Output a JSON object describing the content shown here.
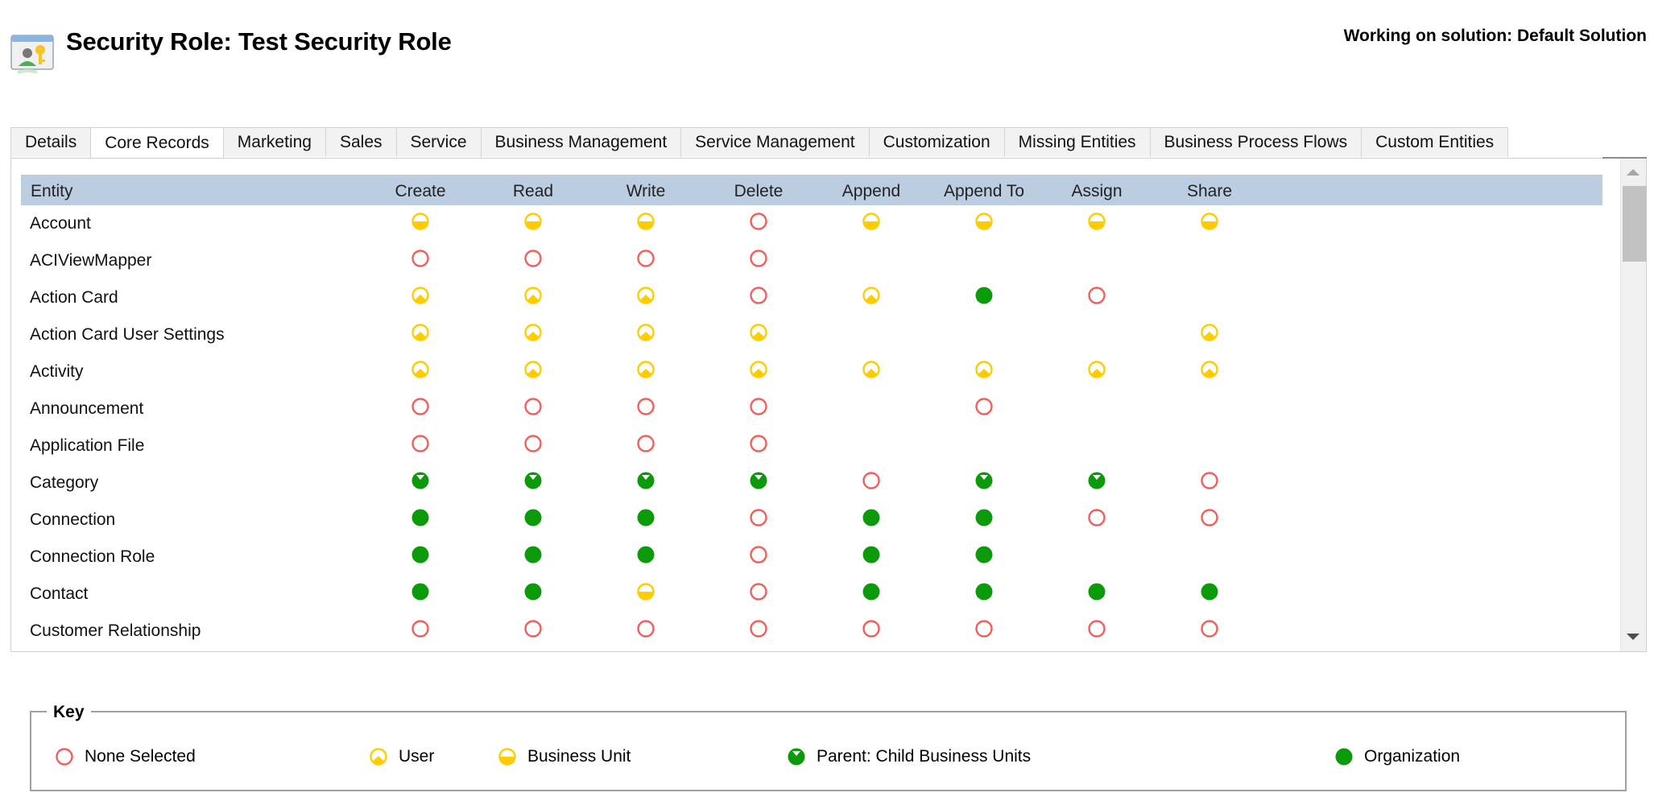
{
  "header": {
    "title": "Security Role: Test Security Role",
    "solution_label": "Working on solution: Default Solution",
    "icon": "security-role-icon"
  },
  "tabs": [
    {
      "label": "Details",
      "active": false
    },
    {
      "label": "Core Records",
      "active": true
    },
    {
      "label": "Marketing",
      "active": false
    },
    {
      "label": "Sales",
      "active": false
    },
    {
      "label": "Service",
      "active": false
    },
    {
      "label": "Business Management",
      "active": false
    },
    {
      "label": "Service Management",
      "active": false
    },
    {
      "label": "Customization",
      "active": false
    },
    {
      "label": "Missing Entities",
      "active": false
    },
    {
      "label": "Business Process Flows",
      "active": false
    },
    {
      "label": "Custom Entities",
      "active": false
    }
  ],
  "grid": {
    "columns": [
      "Entity",
      "Create",
      "Read",
      "Write",
      "Delete",
      "Append",
      "Append To",
      "Assign",
      "Share"
    ],
    "rows": [
      {
        "entity": "Account",
        "privileges": [
          "bu",
          "bu",
          "bu",
          "none",
          "bu",
          "bu",
          "bu",
          "bu"
        ]
      },
      {
        "entity": "ACIViewMapper",
        "privileges": [
          "none",
          "none",
          "none",
          "none",
          "",
          "",
          "",
          ""
        ]
      },
      {
        "entity": "Action Card",
        "privileges": [
          "user",
          "user",
          "user",
          "none",
          "user",
          "org",
          "none",
          ""
        ]
      },
      {
        "entity": "Action Card User Settings",
        "privileges": [
          "user",
          "user",
          "user",
          "user",
          "",
          "",
          "",
          "user"
        ]
      },
      {
        "entity": "Activity",
        "privileges": [
          "user",
          "user",
          "user",
          "user",
          "user",
          "user",
          "user",
          "user"
        ]
      },
      {
        "entity": "Announcement",
        "privileges": [
          "none",
          "none",
          "none",
          "none",
          "",
          "none",
          "",
          ""
        ]
      },
      {
        "entity": "Application File",
        "privileges": [
          "none",
          "none",
          "none",
          "none",
          "",
          "",
          "",
          ""
        ]
      },
      {
        "entity": "Category",
        "privileges": [
          "parent",
          "parent",
          "parent",
          "parent",
          "none",
          "parent",
          "parent",
          "none"
        ]
      },
      {
        "entity": "Connection",
        "privileges": [
          "org",
          "org",
          "org",
          "none",
          "org",
          "org",
          "none",
          "none"
        ]
      },
      {
        "entity": "Connection Role",
        "privileges": [
          "org",
          "org",
          "org",
          "none",
          "org",
          "org",
          "",
          ""
        ]
      },
      {
        "entity": "Contact",
        "privileges": [
          "org",
          "org",
          "bu",
          "none",
          "org",
          "org",
          "org",
          "org"
        ]
      },
      {
        "entity": "Customer Relationship",
        "privileges": [
          "none",
          "none",
          "none",
          "none",
          "none",
          "none",
          "none",
          "none"
        ]
      }
    ]
  },
  "key": {
    "title": "Key",
    "items": [
      {
        "level": "none",
        "label": "None Selected"
      },
      {
        "level": "user",
        "label": "User"
      },
      {
        "level": "bu",
        "label": "Business Unit"
      },
      {
        "level": "parent",
        "label": "Parent: Child Business Units"
      },
      {
        "level": "org",
        "label": "Organization"
      }
    ]
  },
  "colors": {
    "none": "#f0605a",
    "yellow": "#ffcc00",
    "green": "#0a9a0a",
    "header_bg": "#bccde1"
  }
}
